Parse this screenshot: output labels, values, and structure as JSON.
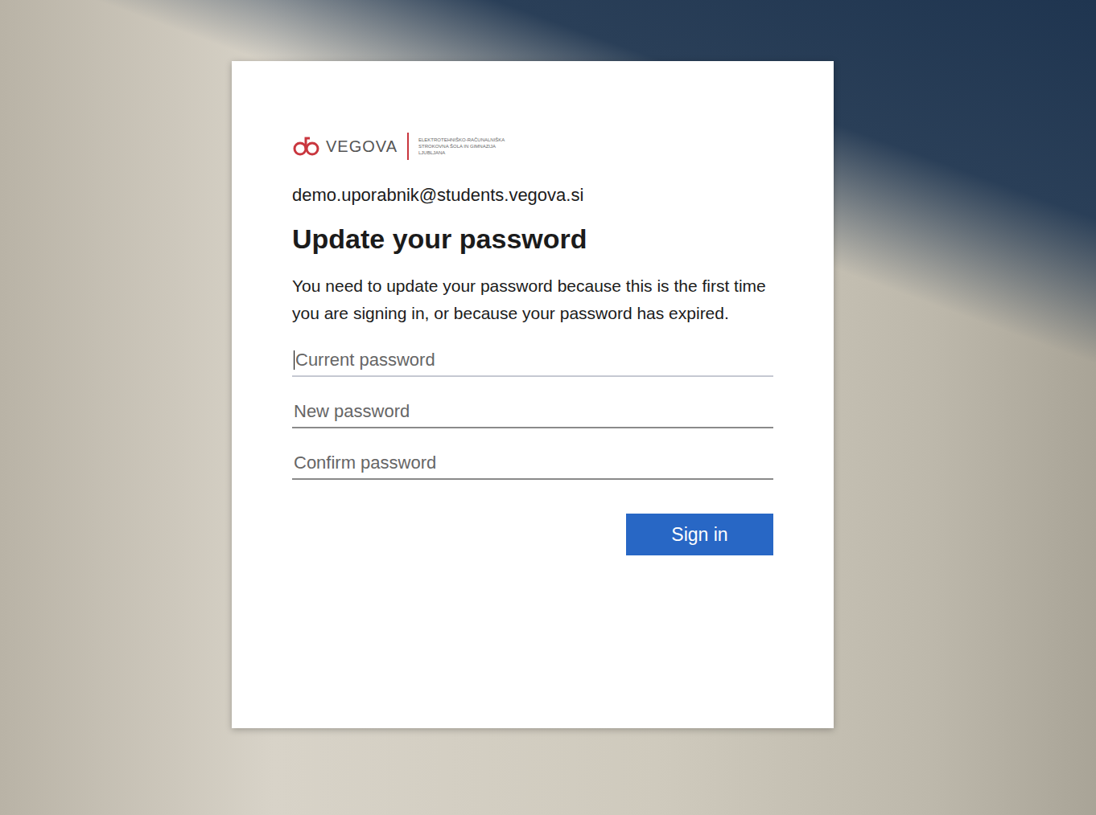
{
  "logo": {
    "name": "VEGOVA",
    "subtitle_lines": [
      "ELEKTROTEHNIŠKO-RAČUNALNIŠKA",
      "STROKOVNA ŠOLA IN GIMNAZIJA",
      "LJUBLJANA"
    ]
  },
  "account": "demo.uporabnik@students.vegova.si",
  "title": "Update your password",
  "description": "You need to update your password because this is the first time you are signing in, or because your password has expired.",
  "fields": [
    {
      "placeholder": "Current password",
      "focused": true
    },
    {
      "placeholder": "New password",
      "focused": false
    },
    {
      "placeholder": "Confirm password",
      "focused": false
    }
  ],
  "button": "Sign in"
}
